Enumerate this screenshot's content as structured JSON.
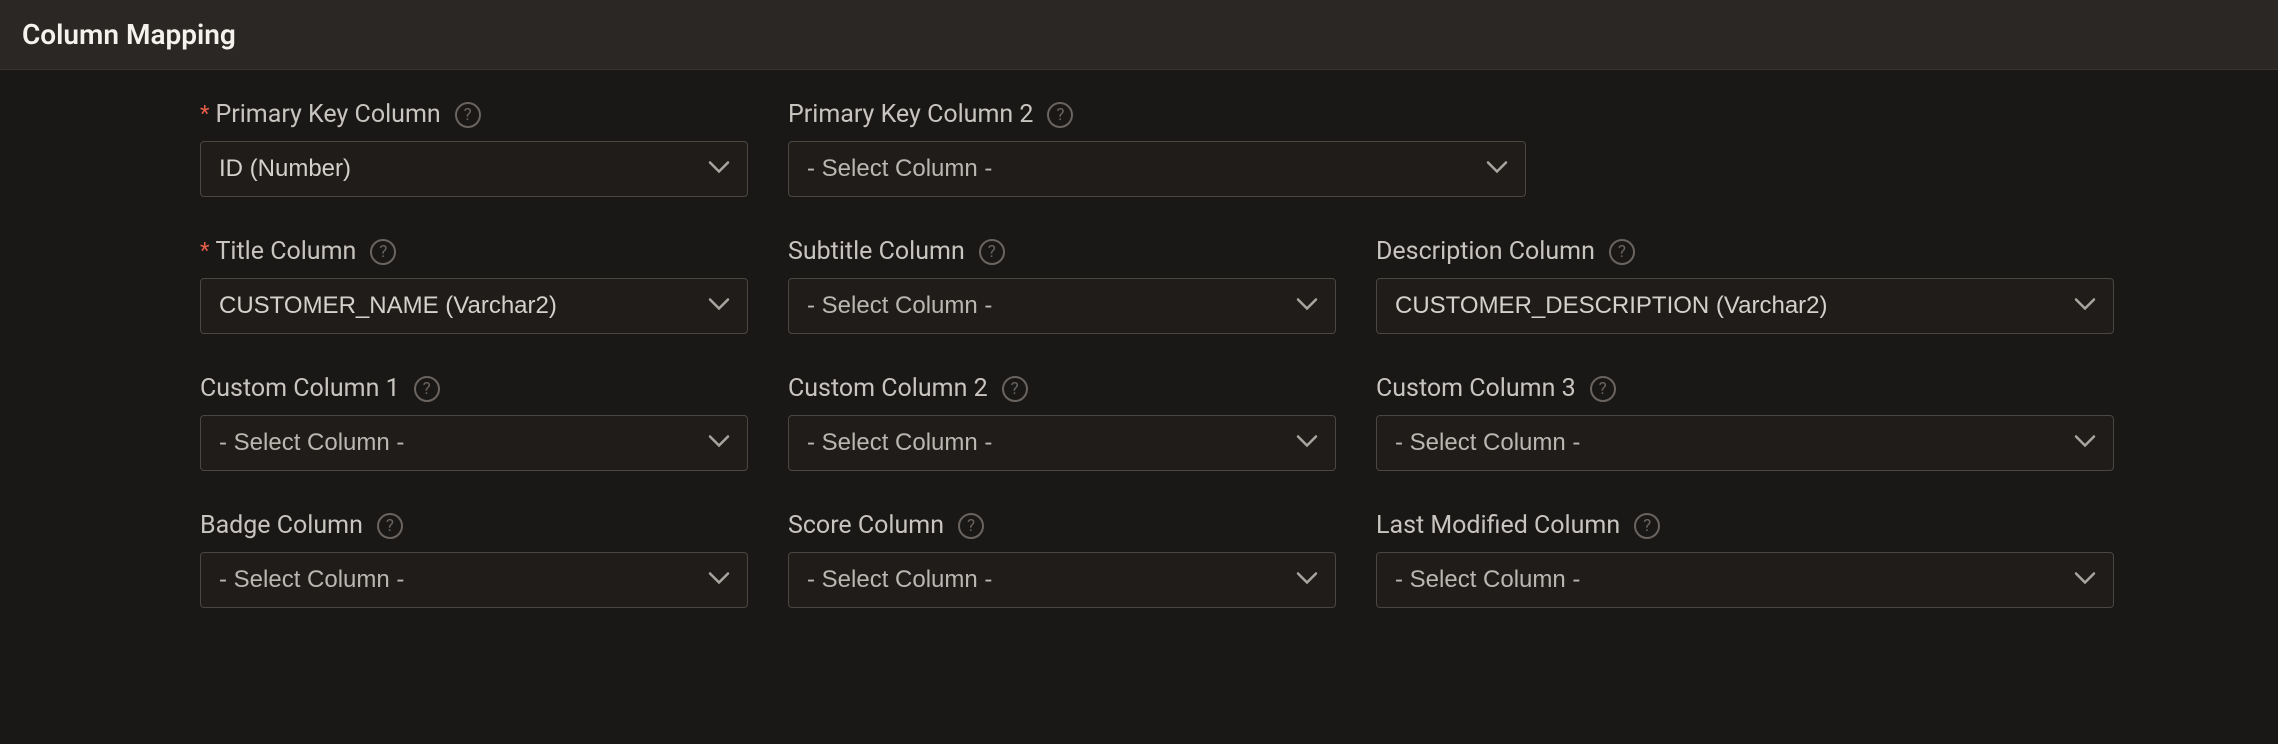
{
  "header": {
    "title": "Column Mapping"
  },
  "placeholder": "- Select Column -",
  "fields": {
    "primaryKey": {
      "label": "Primary Key Column",
      "value": "ID (Number)",
      "required": true
    },
    "primaryKey2": {
      "label": "Primary Key Column 2",
      "value": "- Select Column -",
      "required": false
    },
    "title": {
      "label": "Title Column",
      "value": "CUSTOMER_NAME (Varchar2)",
      "required": true
    },
    "subtitle": {
      "label": "Subtitle Column",
      "value": "- Select Column -",
      "required": false
    },
    "description": {
      "label": "Description Column",
      "value": "CUSTOMER_DESCRIPTION (Varchar2)",
      "required": false
    },
    "custom1": {
      "label": "Custom Column 1",
      "value": "- Select Column -",
      "required": false
    },
    "custom2": {
      "label": "Custom Column 2",
      "value": "- Select Column -",
      "required": false
    },
    "custom3": {
      "label": "Custom Column 3",
      "value": "- Select Column -",
      "required": false
    },
    "badge": {
      "label": "Badge Column",
      "value": "- Select Column -",
      "required": false
    },
    "score": {
      "label": "Score Column",
      "value": "- Select Column -",
      "required": false
    },
    "lastModified": {
      "label": "Last Modified Column",
      "value": "- Select Column -",
      "required": false
    }
  }
}
